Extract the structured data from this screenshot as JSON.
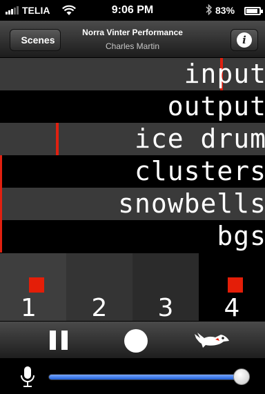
{
  "status": {
    "carrier": "TELIA",
    "time": "9:06 PM",
    "battery": "83%"
  },
  "navbar": {
    "back_label": "Scenes",
    "title": "Norra Vinter Performance",
    "subtitle": "Charles Martin",
    "info_icon": "info-icon"
  },
  "rows": [
    {
      "label": "input",
      "style": "grey",
      "marker": true,
      "level": 0.83
    },
    {
      "label": "output",
      "style": "black",
      "marker": false,
      "level": 0
    },
    {
      "label": "ice drum",
      "style": "grey",
      "marker": true,
      "level": 0.21
    },
    {
      "label": "clusters",
      "style": "black",
      "marker": true,
      "level": 0
    },
    {
      "label": "snowbells",
      "style": "grey",
      "marker": true,
      "level": 0
    },
    {
      "label": "bgs",
      "style": "black",
      "marker": true,
      "level": 0
    }
  ],
  "scenes": [
    {
      "number": "1",
      "active": true
    },
    {
      "number": "2",
      "active": false
    },
    {
      "number": "3",
      "active": false
    },
    {
      "number": "4",
      "active": true
    }
  ],
  "toolbar": {
    "pause_icon": "pause-icon",
    "record_icon": "record-icon",
    "bird_icon": "bird-icon"
  },
  "volume": {
    "icon": "microphone-icon",
    "level": 1.0
  },
  "colors": {
    "accent_red": "#e41e08",
    "slider_blue": "#1f5fd8"
  }
}
